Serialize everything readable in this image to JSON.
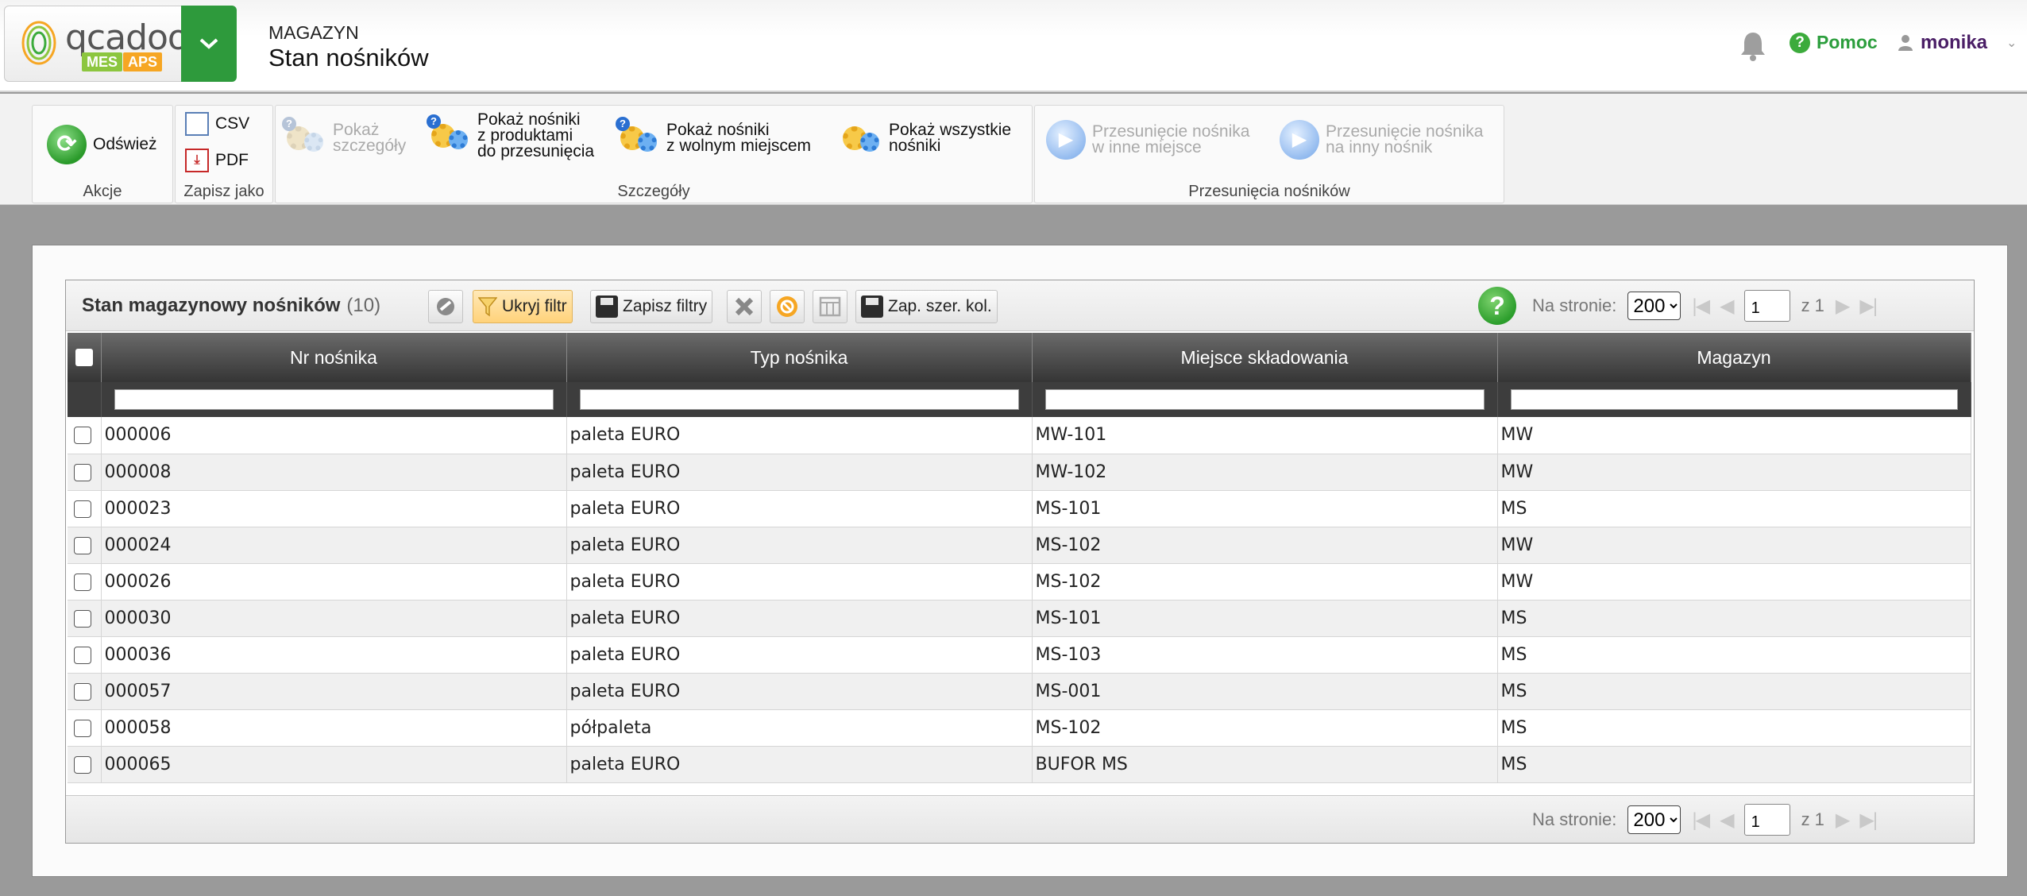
{
  "header": {
    "logo_text": "qcadoo",
    "logo_badges": [
      "MES",
      "APS"
    ],
    "category": "MAGAZYN",
    "title": "Stan nośników",
    "help_label": "Pomoc",
    "user_name": "monika"
  },
  "ribbon": {
    "groups": [
      {
        "label": "Akcje",
        "buttons": [
          {
            "label": "Odśwież",
            "icon": "refresh-icon"
          }
        ]
      },
      {
        "label": "Zapisz jako",
        "buttons": [
          {
            "label": "CSV",
            "icon": "csv-icon"
          },
          {
            "label": "PDF",
            "icon": "pdf-icon"
          }
        ]
      },
      {
        "label": "Szczegóły",
        "buttons": [
          {
            "line1": "Pokaż",
            "line2": "szczegóły",
            "enabled": false,
            "icon": "gears-icon"
          },
          {
            "line1": "Pokaż nośniki",
            "line2": "z produktami",
            "line3": "do przesunięcia",
            "enabled": true,
            "icon": "gears-icon"
          },
          {
            "line1": "Pokaż nośniki",
            "line2": "z wolnym miejscem",
            "enabled": true,
            "icon": "gears-icon"
          },
          {
            "line1": "Pokaż wszystkie",
            "line2": "nośniki",
            "enabled": true,
            "icon": "gears-icon"
          }
        ]
      },
      {
        "label": "Przesunięcia nośników",
        "buttons": [
          {
            "line1": "Przesunięcie nośnika",
            "line2": "w inne miejsce",
            "enabled": false,
            "icon": "play-icon"
          },
          {
            "line1": "Przesunięcie nośnika",
            "line2": "na inny nośnik",
            "enabled": false,
            "icon": "play-icon"
          }
        ]
      }
    ]
  },
  "grid": {
    "title": "Stan magazynowy nośników",
    "count": "(10)",
    "toolbar": {
      "hide_filter": "Ukryj filtr",
      "save_filters": "Zapisz filtry",
      "save_col_width": "Zap. szer. kol."
    },
    "pager": {
      "per_page_label": "Na stronie:",
      "per_page_value": "200",
      "page": "1",
      "of_pages": "z 1"
    },
    "columns": [
      "Nr nośnika",
      "Typ nośnika",
      "Miejsce składowania",
      "Magazyn"
    ],
    "rows": [
      {
        "nr": "000006",
        "typ": "paleta EURO",
        "miejsce": "MW-101",
        "magazyn": "MW"
      },
      {
        "nr": "000008",
        "typ": "paleta EURO",
        "miejsce": "MW-102",
        "magazyn": "MW"
      },
      {
        "nr": "000023",
        "typ": "paleta EURO",
        "miejsce": "MS-101",
        "magazyn": "MS"
      },
      {
        "nr": "000024",
        "typ": "paleta EURO",
        "miejsce": "MS-102",
        "magazyn": "MW"
      },
      {
        "nr": "000026",
        "typ": "paleta EURO",
        "miejsce": "MS-102",
        "magazyn": "MW"
      },
      {
        "nr": "000030",
        "typ": "paleta EURO",
        "miejsce": "MS-101",
        "magazyn": "MS"
      },
      {
        "nr": "000036",
        "typ": "paleta EURO",
        "miejsce": "MS-103",
        "magazyn": "MS"
      },
      {
        "nr": "000057",
        "typ": "paleta EURO",
        "miejsce": "MS-001",
        "magazyn": "MS"
      },
      {
        "nr": "000058",
        "typ": "półpaleta",
        "miejsce": "MS-102",
        "magazyn": "MS"
      },
      {
        "nr": "000065",
        "typ": "paleta EURO",
        "miejsce": "BUFOR MS",
        "magazyn": "MS"
      }
    ]
  },
  "colors": {
    "brand_green": "#2e9a3c",
    "help_green": "#2c9e3d",
    "user_purple": "#4a1e66",
    "header_dark": "#353535"
  }
}
